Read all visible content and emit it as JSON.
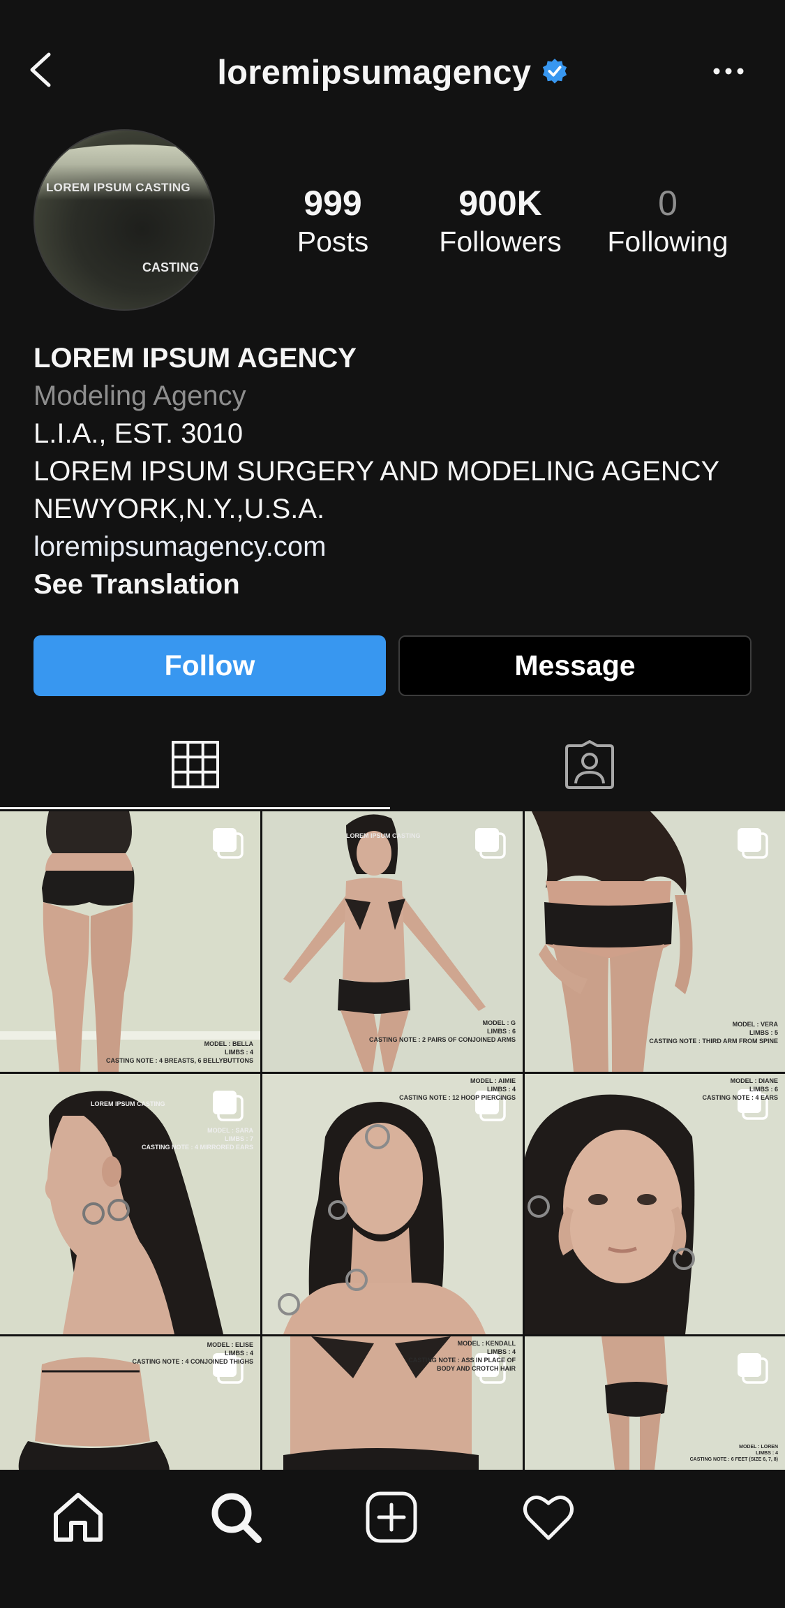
{
  "header": {
    "username": "loremipsumagency",
    "verified": true
  },
  "profile": {
    "avatar_text_top": "LOREM IPSUM CASTING",
    "avatar_text_bottom": "CASTING",
    "stats": {
      "posts": {
        "value": "999",
        "label": "Posts"
      },
      "followers": {
        "value": "900K",
        "label": "Followers"
      },
      "following": {
        "value": "0",
        "label": "Following"
      }
    }
  },
  "bio": {
    "name": "LOREM IPSUM AGENCY",
    "category": "Modeling Agency",
    "line1": "L.I.A., EST. 3010",
    "line2": "LOREM IPSUM SURGERY AND MODELING AGENCY",
    "line3": "NEWYORK,N.Y.,U.S.A.",
    "link": "loremipsumagency.com",
    "translate": "See Translation"
  },
  "actions": {
    "follow_label": "Follow",
    "message_label": "Message"
  },
  "colors": {
    "background": "#121212",
    "follow_button": "#3897f0",
    "verified_badge": "#3897f0",
    "muted_text": "#8e8e8e"
  },
  "posts": [
    {
      "caption": [
        "MODEL : BELLA",
        "LIMBS : 4",
        "CASTING NOTE : 4 BREASTS, 6 BELLYBUTTONS"
      ]
    },
    {
      "caption": [
        "MODEL : G",
        "LIMBS : 6",
        "CASTING NOTE : 2 PAIRS OF CONJOINED ARMS"
      ],
      "top_text": "LOREM IPSUM CASTING"
    },
    {
      "caption": [
        "MODEL : VERA",
        "LIMBS : 5",
        "CASTING NOTE : THIRD ARM FROM SPINE"
      ]
    },
    {
      "caption": [
        "MODEL : SARA",
        "LIMBS : 7",
        "CASTING NOTE : 4 MIRRORED EARS"
      ],
      "top_text": "LOREM IPSUM CASTING"
    },
    {
      "caption": [
        "MODEL : AIMIE",
        "LIMBS : 4",
        "CASTING NOTE : 12 HOOP PIERCINGS"
      ]
    },
    {
      "caption": [
        "MODEL : DIANE",
        "LIMBS : 6",
        "CASTING NOTE : 4 EARS"
      ]
    },
    {
      "caption": [
        "MODEL : ELISE",
        "LIMBS : 4",
        "CASTING NOTE : 4 CONJOINED THIGHS"
      ]
    },
    {
      "caption": [
        "MODEL : KENDALL",
        "LIMBS : 4",
        "CASTING NOTE : ASS IN PLACE OF",
        "BODY AND CROTCH HAIR"
      ]
    },
    {
      "caption": [
        "MODEL : LOREN",
        "LIMBS : 4",
        "CASTING NOTE : 6 FEET (SIZE 6, 7, 8)"
      ]
    }
  ],
  "icons": {
    "back": "chevron-left-icon",
    "more": "more-horizontal-icon",
    "grid": "grid-icon",
    "tagged": "tagged-person-icon",
    "multi": "carousel-icon",
    "home": "home-icon",
    "search": "search-icon",
    "add": "add-post-icon",
    "activity": "heart-icon"
  }
}
